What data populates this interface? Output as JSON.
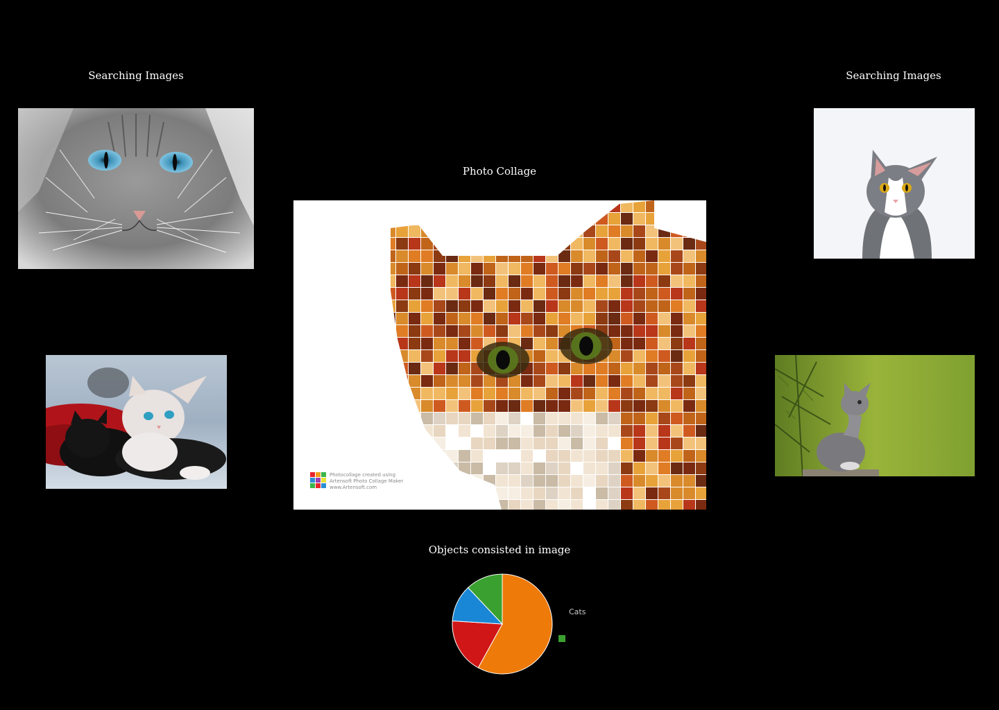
{
  "left_panel": {
    "heading": "Searching Images"
  },
  "right_panel": {
    "heading": "Searching Images"
  },
  "center_panel": {
    "heading": "Photo Collage",
    "watermark_line1": "Photocollage created using",
    "watermark_line2": "Artensoft Photo Collage Maker",
    "watermark_line3": "www.Artensoft.com"
  },
  "chart_panel": {
    "heading": "Objects consisted in image"
  },
  "images": {
    "top_left": "grey-longhair-cat-blue-eyes-photo",
    "bottom_left": "kittens-on-red-blanket-photo",
    "top_right": "grey-white-cat-photo",
    "bottom_right": "kitten-in-forest-photo",
    "collage": "cat-face-mosaic-collage"
  },
  "chart_data": {
    "type": "pie",
    "slices": [
      {
        "label": "Cats",
        "value": 58,
        "color": "#ee7a0a"
      },
      {
        "label": "",
        "value": 18,
        "color": "#d01616"
      },
      {
        "label": "",
        "value": 12,
        "color": "#1a87d6"
      },
      {
        "label": "",
        "value": 12,
        "color": "#3aa030"
      }
    ],
    "legend": {
      "label": "Cats",
      "swatch_color": "#3aa030",
      "placement": "right"
    }
  }
}
